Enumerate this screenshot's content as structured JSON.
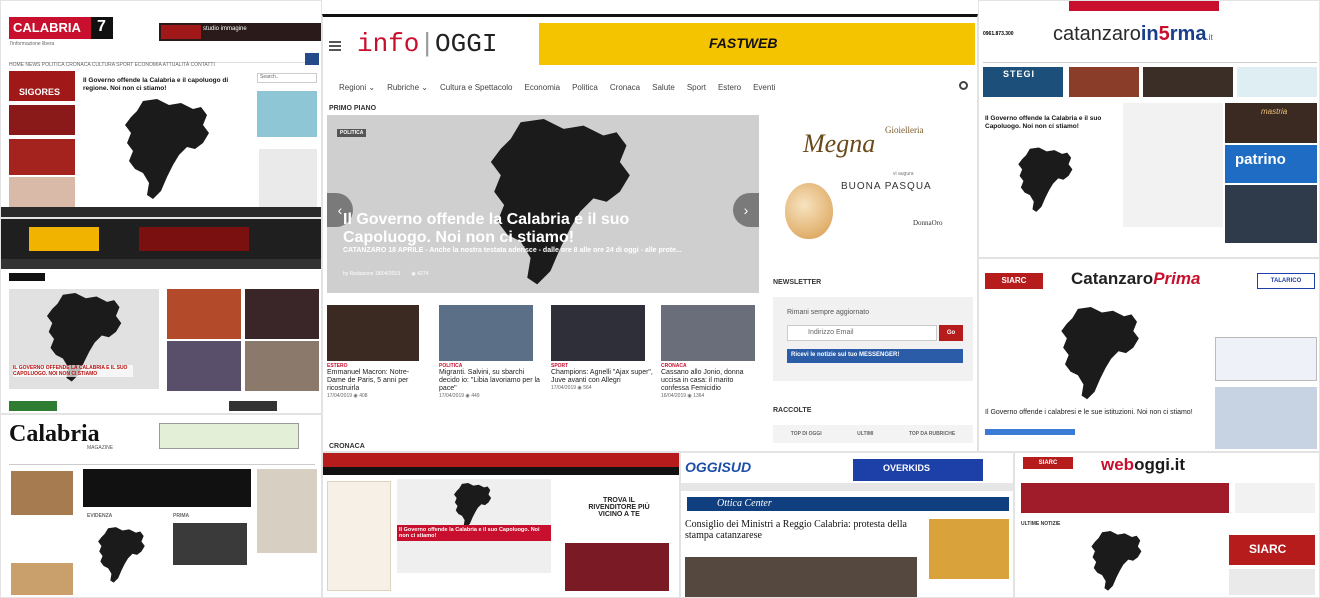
{
  "calabria7": {
    "logo": "CALABRIA",
    "logo_num": "7",
    "tagline": "l'informazione libera",
    "headline": "Il Governo offende la Calabria e il capoluogo di regione. Noi non ci stiamo!",
    "search_placeholder": "Search..",
    "ad_ligors": "SIGORES",
    "ad_studio": "studio immagine"
  },
  "infoggi": {
    "logo_info": "info",
    "logo_oggi": "OGGI",
    "banner": "FASTWEB",
    "nav": [
      "Regioni ⌄",
      "Rubriche ⌄",
      "Cultura e Spettacolo",
      "Economia",
      "Politica",
      "Cronaca",
      "Salute",
      "Sport",
      "Estero",
      "Eventi"
    ],
    "section": "PRIMO PIANO",
    "tag": "POLITICA",
    "headline": "Il Governo offende la Calabria e il suo Capoluogo. Noi non ci stiamo!",
    "excerpt": "CATANZARO 18 APRILE - Anche la nostra testata aderisce - dalle ore 8 alle ore 24 di oggi - alle prote...",
    "byline": "by Redazione 18/04/2019",
    "views": "4274",
    "cards": [
      {
        "cat": "ESTERO",
        "title": "Emmanuel Macron: Notre-Dame de Paris, 5 anni per ricostruirla",
        "date": "17/04/2019",
        "views": "408"
      },
      {
        "cat": "POLITICA",
        "title": "Migranti. Salvini, su sbarchi decido io: \"Libia lavoriamo per la pace\"",
        "date": "17/04/2019",
        "views": "449"
      },
      {
        "cat": "SPORT",
        "title": "Champions: Agnelli \"Ajax super\", Juve avanti con Allegri",
        "date": "17/04/2019",
        "views": "564"
      },
      {
        "cat": "CRONACA",
        "title": "Cassano allo Jonio, donna uccisa in casa: il marito confessa Femicidio",
        "date": "16/04/2019",
        "views": "1364"
      }
    ],
    "ad_brand": "Gioielleria",
    "ad_name": "Megna",
    "ad_line1": "vi augura",
    "ad_line2": "BUONA PASQUA",
    "ad_sign": "DonnaOro",
    "newsletter_title": "NEWSLETTER",
    "newsletter_text": "Rimani sempre aggiornato",
    "email_placeholder": "Indirizzo Email",
    "go_label": "Go",
    "messenger_label": "Ricevi le notizie sul tuo MESSENGER!",
    "raccolte": "RACCOLTE",
    "raccolte_tabs": [
      "TOP DI OGGI",
      "ULTIMI",
      "TOP DA RUBRICHE"
    ],
    "cronaca": "CRONACA"
  },
  "catanzaroinforma": {
    "logo_a": "catanzaro",
    "logo_b": "in",
    "logo_c": "5",
    "logo_d": "rma",
    "logo_e": ".it",
    "code": "0961.873.300",
    "headline": "Il Governo offende la Calabria e il suo Capoluogo. Noi non ci stiamo!",
    "ad_stegi": "STEGI",
    "ad_patrino": "patrino",
    "ad_mastria": "mastria"
  },
  "catanzaroprima": {
    "logo_a": "Catanzaro",
    "logo_b": "Prima",
    "siarc": "SIARC",
    "talarico": "TALARICO",
    "headline": "Il Governo offende i calabresi e le sue istituzioni. Noi non ci stiamo!"
  },
  "calabriadue": {
    "headline": "IL GOVERNO OFFENDE LA CALABRIA E IL SUO CAPOLUOGO. NOI NON CI STIAMO"
  },
  "calabriamag": {
    "logo": "Calabria",
    "logo_sub": "MAGAZINE",
    "tabs": [
      "EVIDENZA",
      "PRIMA"
    ]
  },
  "calabria24": {
    "headline": "Il Governo offende la Calabria e il suo Capoluogo. Noi non ci stiamo!",
    "ad": "TROVA IL RIVENDITORE PIÙ VICINO A TE"
  },
  "oggisud": {
    "logo": "OGGISUD",
    "banner": "OVERKIDS",
    "ottica": "Ottica Center",
    "headline": "Consiglio dei Ministri a Reggio Calabria: protesta della stampa catanzarese"
  },
  "weboggi": {
    "logo_a": "web",
    "logo_b": "oggi.it",
    "siarc": "SIARC",
    "section": "ULTIME NOTIZIE"
  },
  "colors": {
    "red": "#c8102e",
    "dark": "#1b1b1b",
    "fastweb": "#f5c400",
    "nav_dark": "#222"
  }
}
